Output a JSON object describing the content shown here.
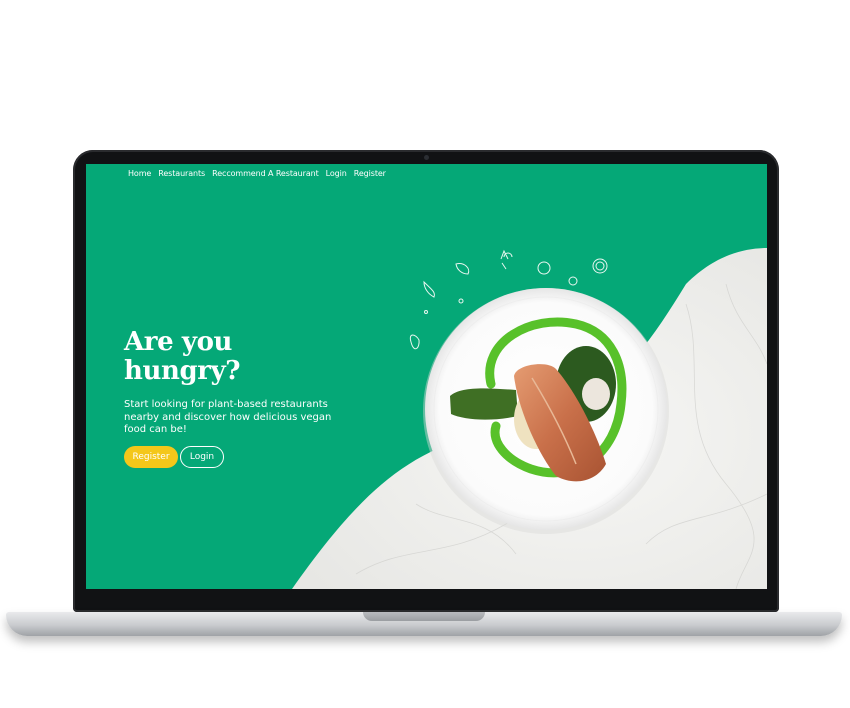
{
  "nav": {
    "items": [
      "Home",
      "Restaurants",
      "Reccommend A Restaurant",
      "Login",
      "Register"
    ]
  },
  "hero": {
    "headline_line1": "Are you",
    "headline_line2": "hungry?",
    "tagline": "Start looking for plant-based restaurants nearby and discover how delicious vegan food can be!",
    "register_label": "Register",
    "login_label": "Login"
  },
  "colors": {
    "brand_green": "#05a877",
    "accent_yellow": "#f4c71a",
    "marble": "#f3f3f1"
  },
  "icons": [
    "leaf-icon",
    "carrot-icon",
    "chili-icon",
    "broccoli-icon",
    "tomato-icon",
    "onion-slice-icon",
    "lemon-slice-icon",
    "pepper-icon",
    "seed-icon"
  ],
  "hero_image": "salmon-plate-image"
}
